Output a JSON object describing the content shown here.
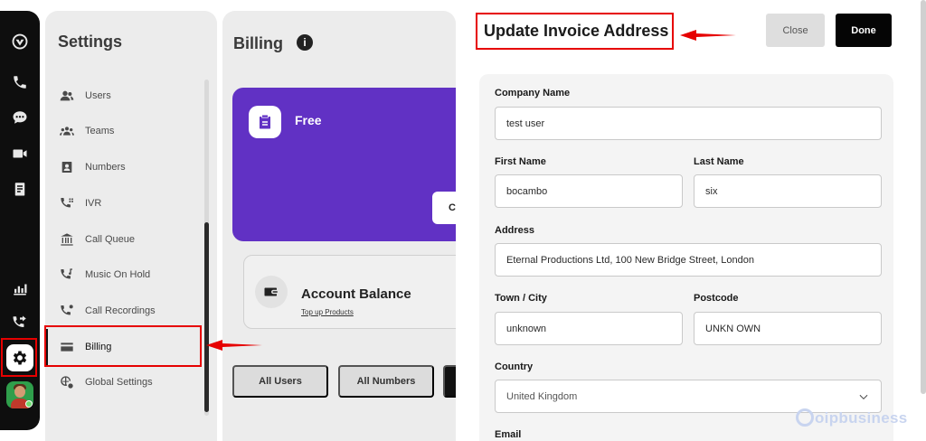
{
  "rail": {
    "icons": [
      "logo-icon",
      "phone-icon",
      "chat-icon",
      "video-icon",
      "notes-icon",
      "stats-icon",
      "phone-forward-icon",
      "gear-icon",
      "avatar"
    ]
  },
  "settings": {
    "title": "Settings",
    "items": [
      {
        "label": "Users",
        "icon": "users-icon"
      },
      {
        "label": "Teams",
        "icon": "teams-icon"
      },
      {
        "label": "Numbers",
        "icon": "numbers-icon"
      },
      {
        "label": "IVR",
        "icon": "ivr-icon"
      },
      {
        "label": "Call Queue",
        "icon": "call-queue-icon"
      },
      {
        "label": "Music On Hold",
        "icon": "music-on-hold-icon"
      },
      {
        "label": "Call Recordings",
        "icon": "call-recordings-icon"
      },
      {
        "label": "Billing",
        "icon": "billing-card-icon"
      },
      {
        "label": "Global Settings",
        "icon": "global-settings-icon"
      }
    ],
    "active": "Billing"
  },
  "billing": {
    "title": "Billing",
    "plan_name": "Free",
    "plan_button_partial": "C",
    "balance_title": "Account Balance",
    "balance_link": "Top up Products",
    "filter_buttons": [
      "All Users",
      "All Numbers"
    ]
  },
  "drawer": {
    "title": "Update Invoice Address",
    "close_label": "Close",
    "done_label": "Done",
    "fields": {
      "company_name": {
        "label": "Company Name",
        "value": "test user"
      },
      "first_name": {
        "label": "First Name",
        "value": "bocambo"
      },
      "last_name": {
        "label": "Last Name",
        "value": "six"
      },
      "address": {
        "label": "Address",
        "value": "Eternal Productions Ltd, 100 New Bridge Street, London"
      },
      "town": {
        "label": "Town / City",
        "value": "unknown"
      },
      "postcode": {
        "label": "Postcode",
        "value": "UNKN OWN"
      },
      "country": {
        "label": "Country",
        "value": "United Kingdom"
      },
      "email": {
        "label": "Email"
      }
    }
  },
  "colors": {
    "plan_purple": "#6131c4",
    "highlight_red": "#e60000",
    "done_black": "#050505"
  },
  "watermark": "oipbusiness"
}
